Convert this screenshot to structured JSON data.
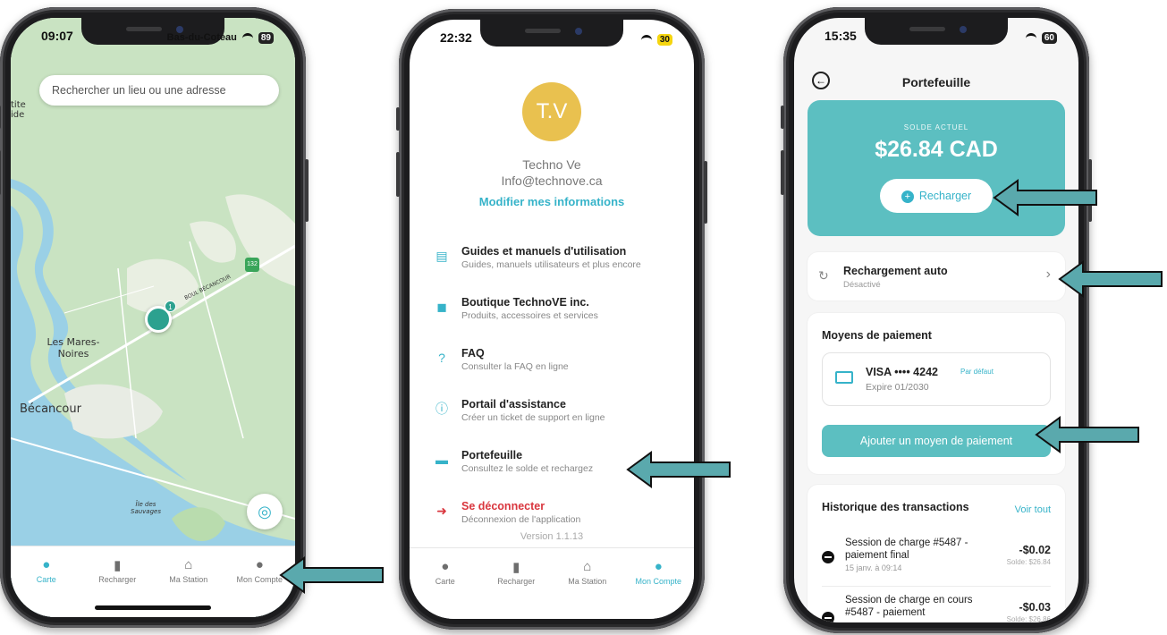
{
  "phone1": {
    "status_time": "09:07",
    "status_loc": "Bas-du-Coteau",
    "battery": "89",
    "search_placeholder": "Rechercher un lieu ou une adresse",
    "map_labels": {
      "edge": "tite ide",
      "les_mares": "Les Mares-Noires",
      "becancour": "Bécancour",
      "ile": "Île des Sauvages",
      "road": "BOUL BÉCANCOUR",
      "hw": "132"
    },
    "pin_count": "1"
  },
  "phone2": {
    "status_time": "22:32",
    "battery": "30",
    "avatar_initials": "T.V",
    "name": "Techno Ve",
    "email": "Info@technove.ca",
    "edit_link": "Modifier mes informations",
    "menu": [
      {
        "title": "Guides et manuels d'utilisation",
        "subtitle": "Guides, manuels utilisateurs et plus encore"
      },
      {
        "title": "Boutique TechnoVE inc.",
        "subtitle": "Produits, accessoires et services"
      },
      {
        "title": "FAQ",
        "subtitle": "Consulter la FAQ en ligne"
      },
      {
        "title": "Portail d'assistance",
        "subtitle": "Créer un ticket de support en ligne"
      },
      {
        "title": "Portefeuille",
        "subtitle": "Consultez le solde et rechargez"
      },
      {
        "title": "Se déconnecter",
        "subtitle": "Déconnexion de l'application"
      }
    ],
    "version": "Version 1.1.13"
  },
  "phone3": {
    "status_time": "15:35",
    "battery": "60",
    "title": "Portefeuille",
    "balance_label": "SOLDE ACTUEL",
    "balance": "$26.84 CAD",
    "recharge_label": "Recharger",
    "auto_title": "Rechargement auto",
    "auto_status": "Désactivé",
    "payment_header": "Moyens de paiement",
    "card_number": "VISA •••• 4242",
    "card_default": "Par défaut",
    "card_expiry": "Expire 01/2030",
    "add_payment": "Ajouter un moyen de paiement",
    "history_header": "Historique des transactions",
    "history_all": "Voir tout",
    "transactions": [
      {
        "title": "Session de charge #5487 - paiement final",
        "date": "15 janv. à 09:14",
        "amount": "-$0.02",
        "balance": "Solde: $26.84"
      },
      {
        "title": "Session de charge en cours #5487 - paiement",
        "date": "",
        "amount": "-$0.03",
        "balance": "Solde: $26.86"
      }
    ]
  },
  "tabs": [
    "Carte",
    "Recharger",
    "Ma Station",
    "Mon Compte"
  ],
  "accent_color": "#36b3c9",
  "arrow_color": "#5aa9ad"
}
